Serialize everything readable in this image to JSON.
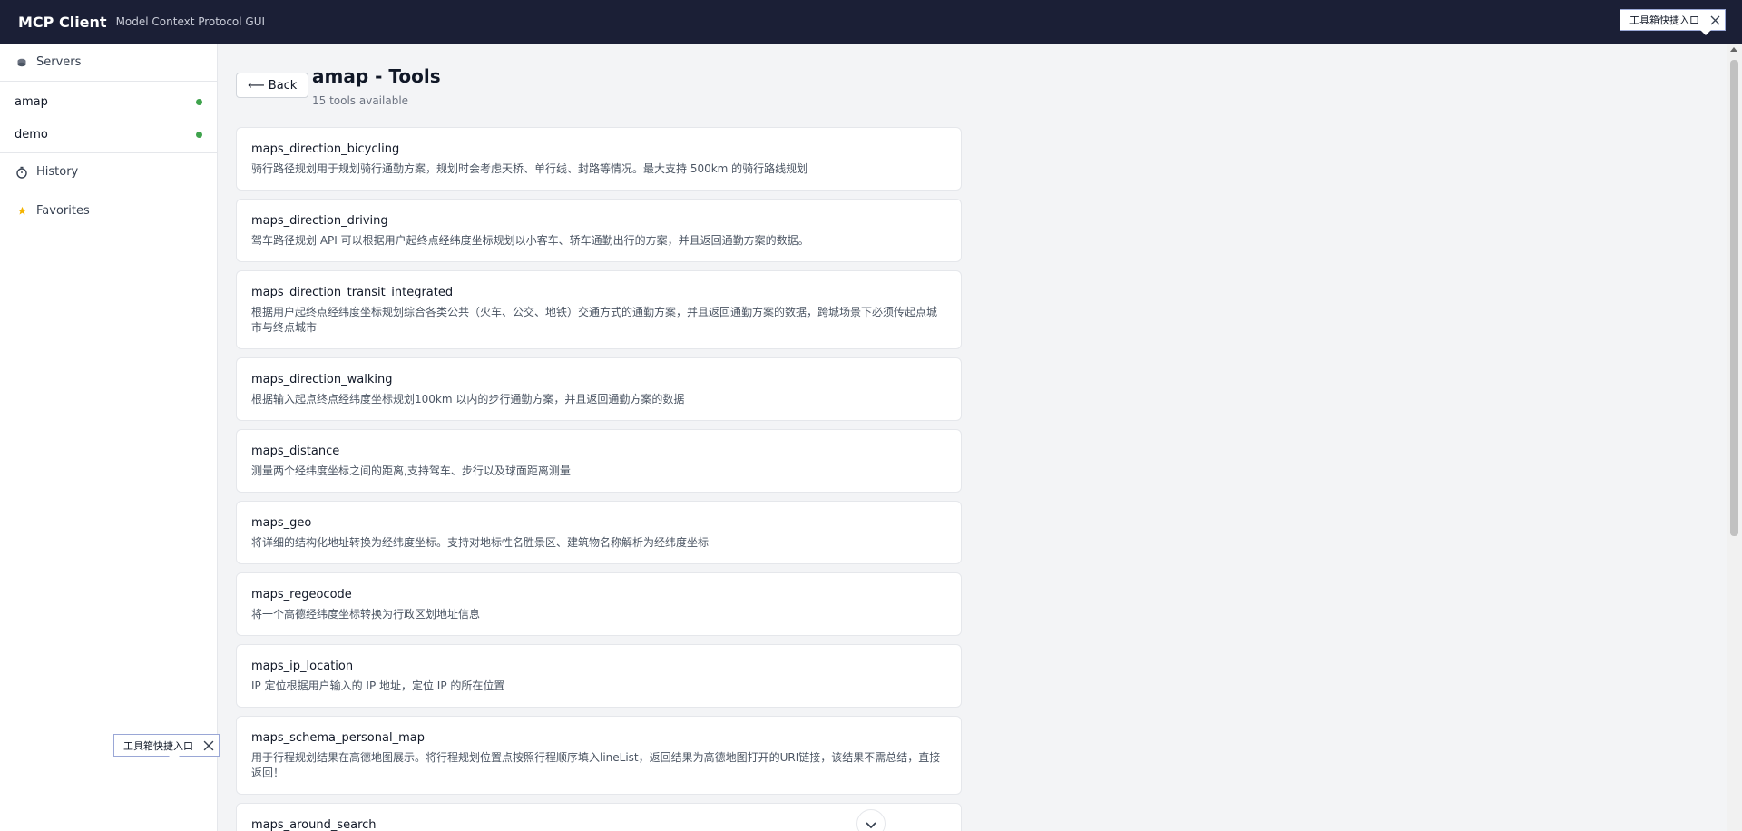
{
  "header": {
    "brand": "MCP Client",
    "subtitle": "Model Context Protocol GUI"
  },
  "sidebar": {
    "servers_label": "Servers",
    "servers": [
      {
        "name": "amap",
        "status_color": "#3fa34d"
      },
      {
        "name": "demo",
        "status_color": "#3fa34d"
      }
    ],
    "history_label": "History",
    "favorites_label": "Favorites"
  },
  "main": {
    "back_label": "⟵ Back",
    "title": "amap - Tools",
    "count": "15 tools available",
    "tools": [
      {
        "name": "maps_direction_bicycling",
        "desc": "骑行路径规划用于规划骑行通勤方案，规划时会考虑天桥、单行线、封路等情况。最大支持 500km 的骑行路线规划"
      },
      {
        "name": "maps_direction_driving",
        "desc": "驾车路径规划 API 可以根据用户起终点经纬度坐标规划以小客车、轿车通勤出行的方案，并且返回通勤方案的数据。"
      },
      {
        "name": "maps_direction_transit_integrated",
        "desc": "根据用户起终点经纬度坐标规划综合各类公共（火车、公交、地铁）交通方式的通勤方案，并且返回通勤方案的数据，跨城场景下必须传起点城市与终点城市"
      },
      {
        "name": "maps_direction_walking",
        "desc": "根据输入起点终点经纬度坐标规划100km 以内的步行通勤方案，并且返回通勤方案的数据"
      },
      {
        "name": "maps_distance",
        "desc": "测量两个经纬度坐标之间的距离,支持驾车、步行以及球面距离测量"
      },
      {
        "name": "maps_geo",
        "desc": "将详细的结构化地址转换为经纬度坐标。支持对地标性名胜景区、建筑物名称解析为经纬度坐标"
      },
      {
        "name": "maps_regeocode",
        "desc": "将一个高德经纬度坐标转换为行政区划地址信息"
      },
      {
        "name": "maps_ip_location",
        "desc": "IP 定位根据用户输入的 IP 地址，定位 IP 的所在位置"
      },
      {
        "name": "maps_schema_personal_map",
        "desc": "用于行程规划结果在高德地图展示。将行程规划位置点按照行程顺序填入lineList，返回结果为高德地图打开的URI链接，该结果不需总结，直接返回！"
      },
      {
        "name": "maps_around_search",
        "desc": ""
      }
    ]
  },
  "tooltips": {
    "top_right": "工具箱快捷入口",
    "bottom_left": "工具箱快捷入口"
  },
  "colors": {
    "header_bg": "#1b1f36",
    "status_online": "#3fa34d",
    "favorite_star": "#f5b400"
  }
}
